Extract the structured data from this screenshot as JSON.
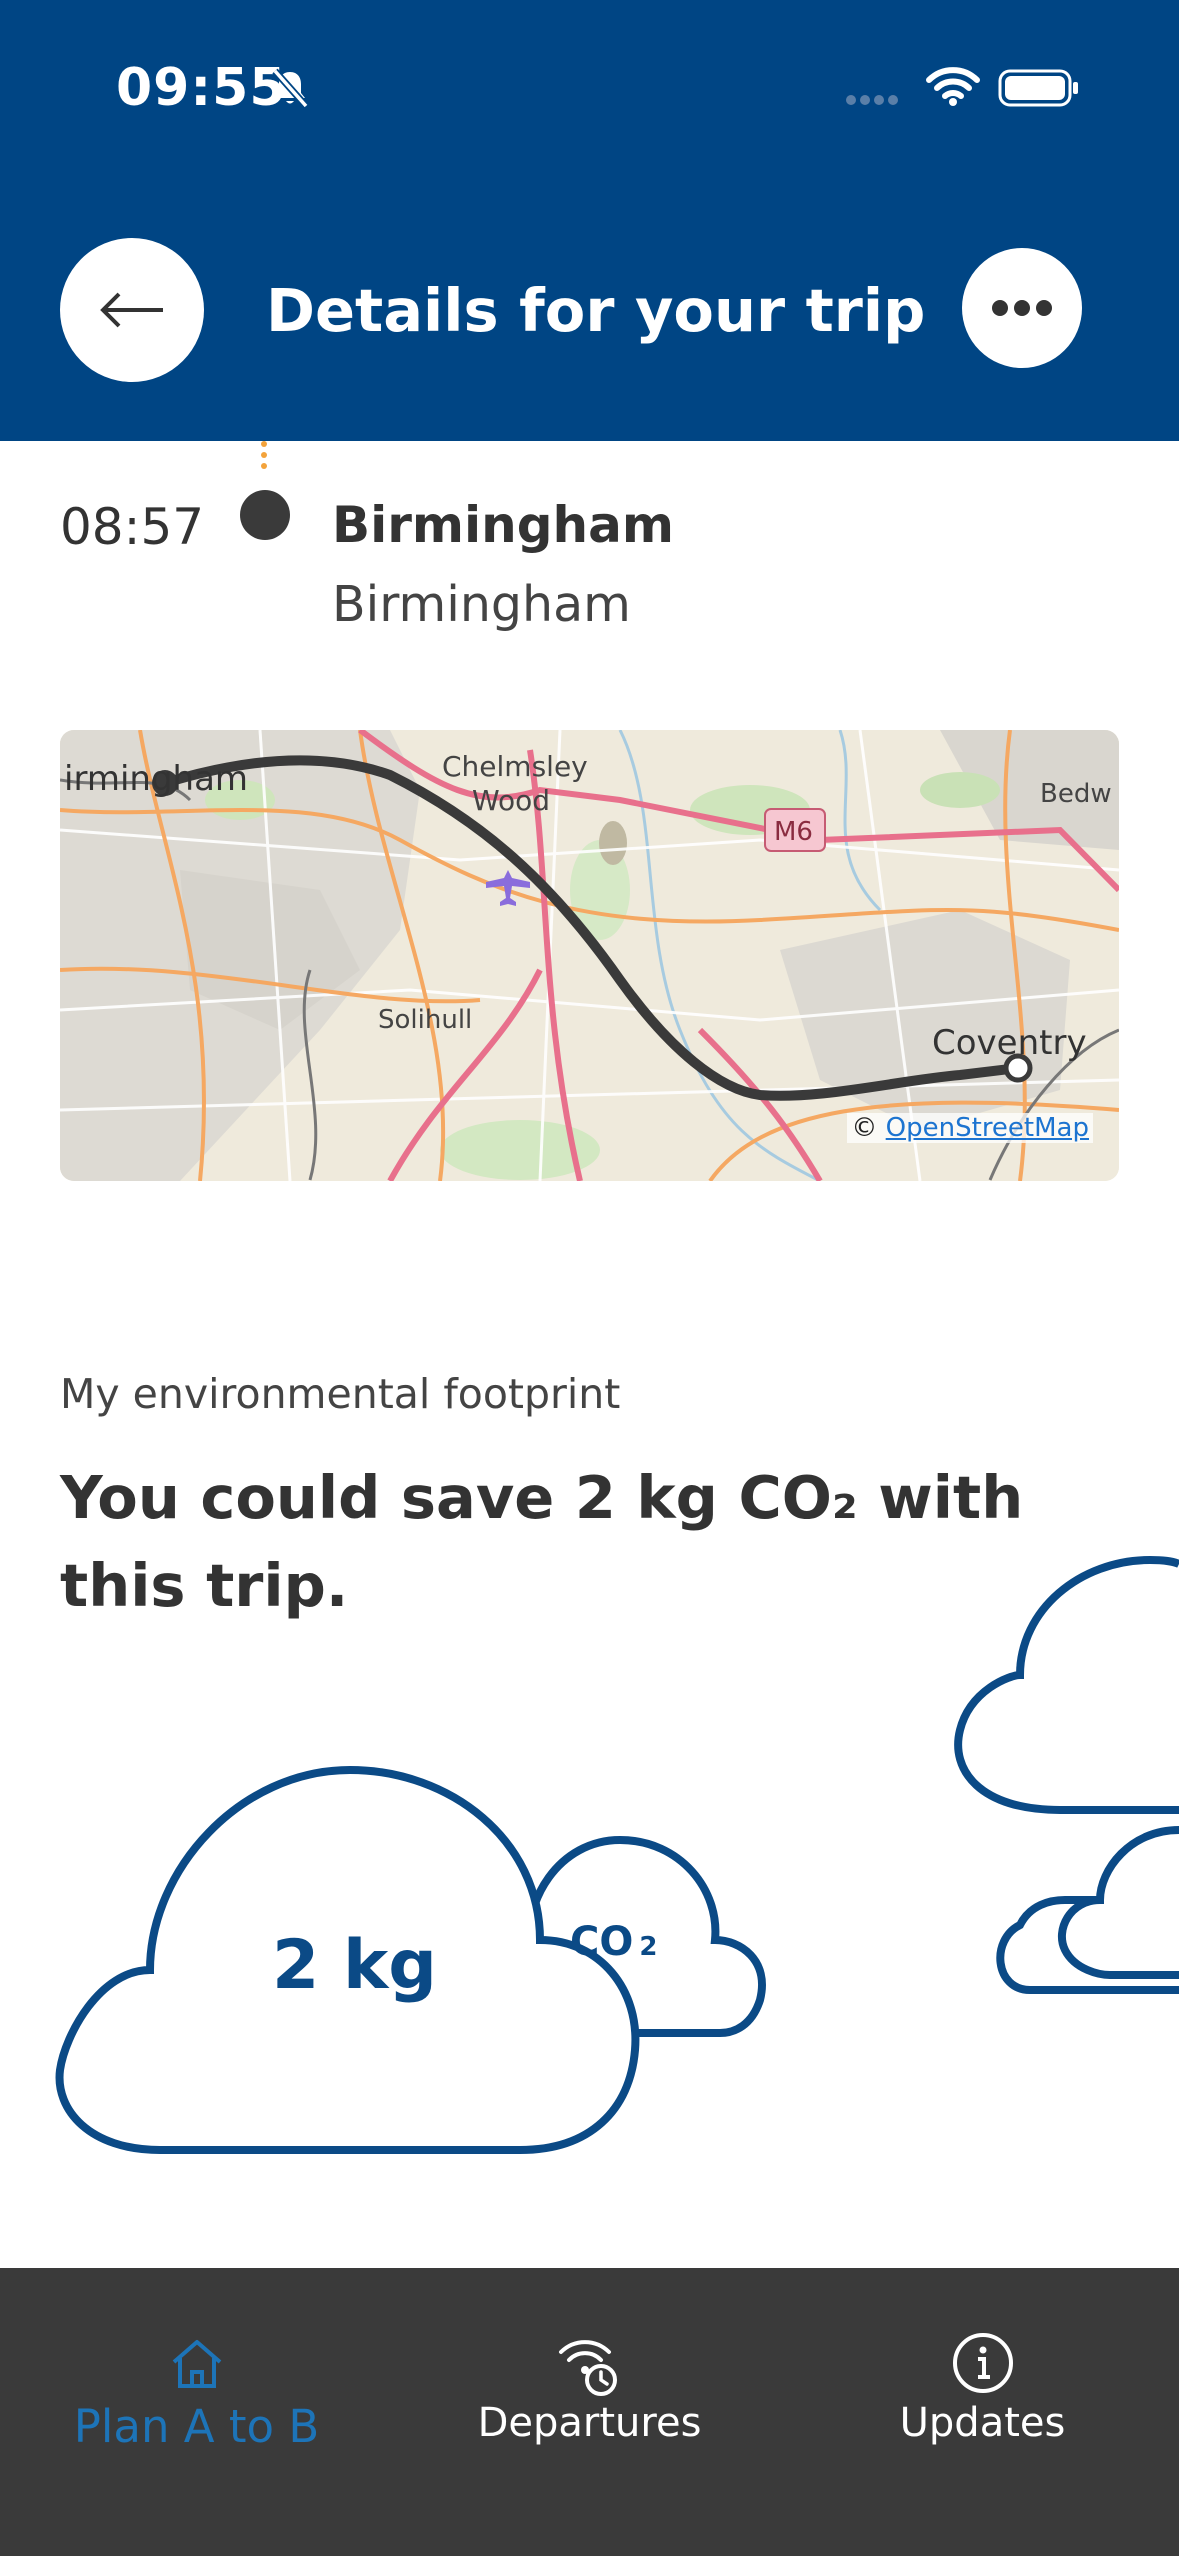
{
  "status_bar": {
    "time": "09:55"
  },
  "header": {
    "title": "Details for your trip"
  },
  "stop": {
    "time": "08:57",
    "name": "Birmingham",
    "subtitle": "Birmingham"
  },
  "map": {
    "labels": [
      "irmingham",
      "Chelmsley",
      "Wood",
      "Solihull",
      "Coventry",
      "M6",
      "Bedw"
    ],
    "attribution_prefix": "©",
    "attribution_link": "OpenStreetMap"
  },
  "environment": {
    "label": "My environmental footprint",
    "headline": "You could save 2 kg CO₂ with this trip.",
    "cloud_amount": "2 kg",
    "cloud_gas": "CO",
    "cloud_gas_sub": "2"
  },
  "tabbar": {
    "tabs": [
      {
        "label": "Plan A to B",
        "icon": "home-icon",
        "active": true
      },
      {
        "label": "Departures",
        "icon": "departures-icon",
        "active": false
      },
      {
        "label": "Updates",
        "icon": "info-icon",
        "active": false
      }
    ]
  },
  "colors": {
    "header_bg": "#004584",
    "tabbar_bg": "#3a3a3a",
    "active_tab": "#1d74b8",
    "cloud_stroke": "#0b4a86",
    "route": "#3a3a3a"
  }
}
